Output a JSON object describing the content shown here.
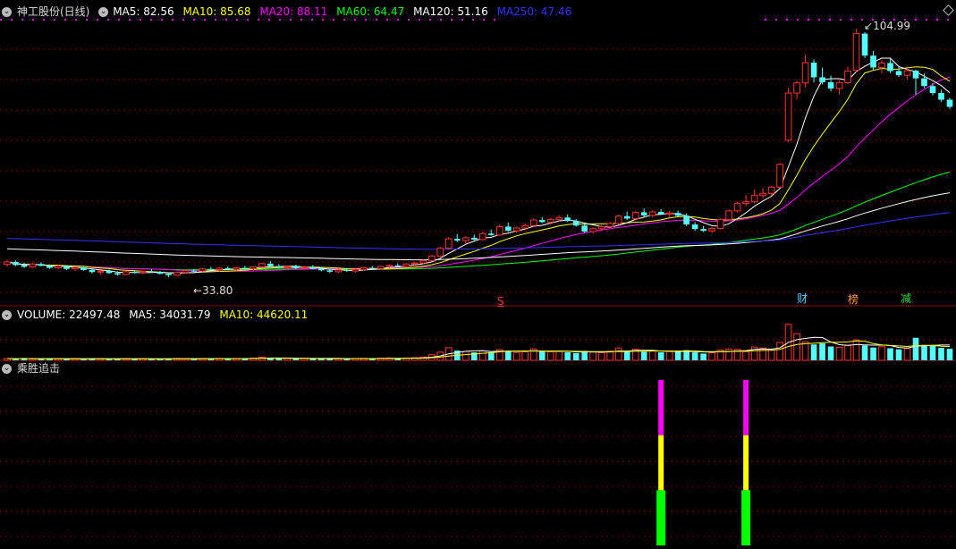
{
  "header": {
    "title": "神工股份(日线)",
    "ma5": "MA5: 82.56",
    "ma10": "MA10: 85.68",
    "ma20": "MA20: 88.11",
    "ma60": "MA60: 64.47",
    "ma120": "MA120: 51.16",
    "ma250": "MA250: 47.46"
  },
  "volume_header": {
    "label": "VOLUME: 22497.48",
    "ma5": "MA5: 34031.79",
    "ma10": "MA10: 44620.11"
  },
  "indicator_header": {
    "label": "乘胜追击"
  },
  "markers": {
    "high": "104.99",
    "low": "33.80",
    "s": "S",
    "cai": "财",
    "bang": "榜",
    "jian": "减"
  },
  "colors": {
    "up": "#ff3232",
    "down": "#54ffff",
    "ma5": "#ffffff",
    "ma10": "#ffff00",
    "ma20": "#ff00ff",
    "ma60": "#00ff00",
    "ma120": "#ffffff",
    "ma250": "#3232ff",
    "grid": "#7a0000"
  },
  "chart_data": [
    {
      "type": "candlestick",
      "title": "神工股份(日线)",
      "y_range": [
        30,
        108
      ],
      "annotations": {
        "high": 104.99,
        "low": 33.8
      },
      "moving_averages": [
        {
          "name": "MA5",
          "last": 82.56
        },
        {
          "name": "MA10",
          "last": 85.68
        },
        {
          "name": "MA20",
          "last": 88.11
        },
        {
          "name": "MA60",
          "last": 64.47
        },
        {
          "name": "MA120",
          "last": 51.16
        },
        {
          "name": "MA250",
          "last": 47.46
        }
      ],
      "ohlc": [
        [
          37.5,
          38.8,
          36.9,
          38.2
        ],
        [
          38.2,
          38.6,
          37.0,
          37.3
        ],
        [
          37.3,
          38.0,
          36.5,
          36.8
        ],
        [
          36.8,
          37.9,
          36.5,
          37.6
        ],
        [
          37.6,
          38.1,
          36.9,
          37.1
        ],
        [
          37.1,
          37.5,
          36.2,
          36.5
        ],
        [
          36.5,
          37.4,
          36.1,
          37.0
        ],
        [
          37.0,
          37.3,
          35.9,
          36.2
        ],
        [
          36.2,
          36.9,
          35.6,
          36.6
        ],
        [
          36.6,
          37.0,
          35.7,
          35.9
        ],
        [
          35.9,
          36.4,
          34.9,
          35.3
        ],
        [
          35.3,
          35.9,
          34.5,
          35.6
        ],
        [
          35.6,
          36.0,
          34.8,
          35.0
        ],
        [
          35.0,
          35.5,
          34.3,
          34.6
        ],
        [
          34.6,
          35.7,
          34.4,
          35.4
        ],
        [
          35.4,
          35.9,
          34.9,
          35.2
        ],
        [
          35.2,
          35.8,
          34.8,
          35.5
        ],
        [
          35.5,
          36.1,
          35.1,
          35.3
        ],
        [
          35.3,
          35.6,
          34.6,
          34.8
        ],
        [
          34.8,
          35.2,
          33.8,
          34.4
        ],
        [
          34.4,
          35.5,
          34.2,
          35.2
        ],
        [
          35.2,
          36.0,
          34.9,
          35.7
        ],
        [
          35.7,
          36.2,
          35.1,
          35.6
        ],
        [
          35.6,
          36.5,
          35.3,
          36.2
        ],
        [
          36.2,
          36.8,
          35.7,
          36.0
        ],
        [
          36.0,
          36.6,
          35.4,
          36.4
        ],
        [
          36.4,
          36.9,
          35.9,
          36.1
        ],
        [
          36.1,
          36.7,
          35.6,
          36.5
        ],
        [
          36.5,
          37.1,
          36.0,
          36.3
        ],
        [
          36.3,
          36.9,
          35.6,
          36.8
        ],
        [
          36.8,
          38.0,
          36.5,
          37.7
        ],
        [
          37.7,
          38.4,
          36.8,
          37.0
        ],
        [
          37.0,
          37.6,
          36.3,
          36.6
        ],
        [
          36.6,
          37.2,
          36.0,
          36.9
        ],
        [
          36.9,
          37.4,
          36.2,
          36.4
        ],
        [
          36.4,
          37.0,
          35.8,
          36.7
        ],
        [
          36.7,
          37.3,
          36.1,
          36.2
        ],
        [
          36.2,
          36.8,
          35.5,
          35.8
        ],
        [
          35.8,
          36.3,
          35.0,
          35.4
        ],
        [
          35.4,
          36.1,
          35.0,
          35.9
        ],
        [
          35.9,
          36.5,
          35.3,
          35.6
        ],
        [
          35.6,
          36.2,
          35.1,
          36.0
        ],
        [
          36.0,
          36.8,
          35.7,
          36.5
        ],
        [
          36.5,
          37.0,
          36.0,
          36.3
        ],
        [
          36.3,
          37.1,
          36.1,
          36.9
        ],
        [
          36.9,
          37.5,
          36.4,
          37.2
        ],
        [
          37.2,
          37.8,
          36.8,
          37.0
        ],
        [
          37.0,
          37.9,
          36.8,
          37.6
        ],
        [
          37.6,
          38.2,
          37.1,
          37.9
        ],
        [
          37.9,
          38.9,
          37.5,
          38.6
        ],
        [
          38.6,
          40.2,
          38.3,
          39.9
        ],
        [
          39.9,
          42.5,
          39.6,
          42.1
        ],
        [
          42.1,
          45.3,
          41.8,
          44.8
        ],
        [
          44.8,
          46.2,
          43.9,
          44.3
        ],
        [
          44.3,
          45.5,
          43.5,
          45.1
        ],
        [
          45.1,
          46.0,
          44.4,
          44.6
        ],
        [
          44.6,
          46.8,
          44.3,
          46.3
        ],
        [
          46.3,
          47.5,
          45.7,
          45.9
        ],
        [
          45.9,
          48.9,
          45.6,
          48.3
        ],
        [
          48.3,
          49.5,
          46.8,
          47.1
        ],
        [
          47.1,
          48.3,
          46.5,
          47.9
        ],
        [
          47.9,
          49.2,
          47.3,
          48.6
        ],
        [
          48.6,
          50.6,
          48.2,
          50.2
        ],
        [
          50.2,
          51.0,
          49.3,
          49.6
        ],
        [
          49.6,
          50.8,
          48.9,
          50.3
        ],
        [
          50.3,
          51.4,
          49.8,
          50.9
        ],
        [
          50.9,
          51.8,
          49.6,
          49.9
        ],
        [
          49.9,
          50.5,
          48.3,
          48.6
        ],
        [
          48.6,
          49.2,
          46.5,
          46.9
        ],
        [
          46.9,
          48.1,
          46.3,
          47.7
        ],
        [
          47.7,
          48.8,
          47.1,
          48.3
        ],
        [
          48.3,
          49.6,
          47.9,
          49.2
        ],
        [
          49.2,
          51.7,
          48.8,
          51.3
        ],
        [
          51.3,
          52.6,
          50.2,
          50.6
        ],
        [
          50.6,
          52.8,
          50.1,
          52.4
        ],
        [
          52.4,
          53.5,
          51.2,
          51.5
        ],
        [
          51.5,
          52.9,
          51.0,
          52.5
        ],
        [
          52.5,
          53.3,
          51.6,
          51.9
        ],
        [
          51.9,
          52.7,
          50.9,
          52.2
        ],
        [
          52.2,
          52.9,
          51.1,
          51.4
        ],
        [
          51.4,
          52.1,
          48.5,
          48.9
        ],
        [
          48.9,
          49.6,
          47.1,
          47.6
        ],
        [
          47.6,
          48.4,
          46.8,
          47.1
        ],
        [
          47.1,
          48.2,
          46.5,
          47.8
        ],
        [
          47.8,
          50.7,
          47.5,
          50.3
        ],
        [
          50.3,
          53.2,
          50.0,
          52.8
        ],
        [
          52.8,
          55.5,
          52.3,
          54.9
        ],
        [
          54.9,
          57.4,
          54.1,
          55.4
        ],
        [
          55.4,
          58.8,
          55.0,
          57.2
        ],
        [
          57.2,
          59.4,
          56.4,
          57.8
        ],
        [
          57.8,
          60.0,
          57.1,
          59.6
        ],
        [
          59.6,
          66.5,
          59.4,
          66.1
        ],
        [
          73.0,
          88.0,
          72.5,
          86.5
        ],
        [
          86.5,
          90.0,
          84.8,
          89.4
        ],
        [
          89.4,
          97.5,
          88.2,
          95.2
        ],
        [
          95.2,
          96.1,
          89.5,
          91.0
        ],
        [
          91.0,
          93.8,
          89.0,
          89.6
        ],
        [
          89.6,
          91.5,
          87.0,
          87.8
        ],
        [
          87.8,
          90.2,
          86.2,
          89.5
        ],
        [
          89.5,
          94.0,
          89.0,
          92.8
        ],
        [
          93.0,
          104.99,
          92.5,
          103.5
        ],
        [
          103.5,
          103.9,
          96.5,
          97.2
        ],
        [
          97.2,
          98.6,
          93.0,
          93.8
        ],
        [
          93.8,
          95.9,
          92.2,
          95.1
        ],
        [
          95.1,
          96.4,
          92.2,
          92.8
        ],
        [
          92.8,
          94.0,
          91.1,
          91.6
        ],
        [
          91.6,
          93.5,
          90.4,
          92.9
        ],
        [
          92.9,
          93.2,
          86.0,
          90.7
        ],
        [
          90.7,
          92.1,
          87.9,
          88.5
        ],
        [
          88.5,
          89.3,
          85.8,
          86.5
        ],
        [
          86.5,
          87.4,
          84.0,
          84.6
        ],
        [
          84.6,
          85.1,
          82.0,
          82.56
        ]
      ]
    },
    {
      "type": "bar",
      "title": "VOLUME",
      "last_volume": 22497.48,
      "ma5": 34031.79,
      "ma10": 44620.11,
      "y_range": [
        0,
        75000
      ],
      "values": [
        3500,
        3200,
        4100,
        2800,
        3000,
        3600,
        2900,
        3300,
        2700,
        3100,
        3800,
        2600,
        2900,
        3400,
        2500,
        3000,
        2800,
        3200,
        2700,
        2900,
        3600,
        3300,
        4000,
        3100,
        3500,
        3700,
        3000,
        3400,
        3900,
        4300,
        6200,
        4800,
        3600,
        4100,
        3200,
        3800,
        2900,
        3500,
        3100,
        3300,
        3000,
        3600,
        3900,
        3400,
        4200,
        4700,
        3900,
        4500,
        5000,
        6400,
        11000,
        16000,
        24500,
        19000,
        17500,
        15500,
        18500,
        16000,
        21000,
        18500,
        15500,
        17000,
        22000,
        18000,
        16500,
        17500,
        15800,
        14200,
        18500,
        16200,
        15200,
        17800,
        24000,
        17800,
        21500,
        16800,
        18800,
        15900,
        17200,
        16600,
        19800,
        15500,
        13200,
        14800,
        20000,
        22000,
        21500,
        17000,
        26000,
        24000,
        20500,
        35000,
        70000,
        52000,
        36000,
        31000,
        33000,
        27000,
        25500,
        29000,
        40000,
        29000,
        25000,
        26500,
        23500,
        21500,
        23000,
        44000,
        30000,
        28000,
        24500,
        22497
      ]
    },
    {
      "type": "bar",
      "title": "乘胜追击",
      "signals": [
        {
          "bar_index": 77,
          "segments": [
            "green",
            "yellow",
            "magenta"
          ]
        },
        {
          "bar_index": 87,
          "segments": [
            "green",
            "yellow",
            "magenta"
          ]
        }
      ]
    }
  ]
}
